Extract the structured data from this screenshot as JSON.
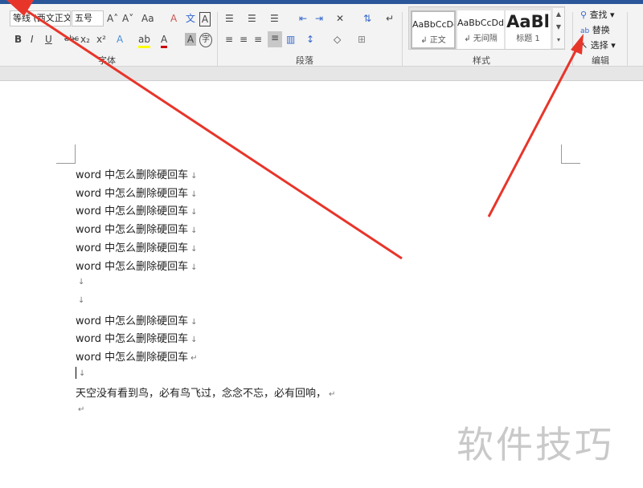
{
  "ribbon": {
    "font_name": "等线 (西文正文)",
    "font_size": "五号",
    "font_group": "字体",
    "paragraph_group": "段落",
    "styles_group": "样式",
    "editing_group": "编辑",
    "styles": [
      {
        "preview": "AaBbCcDd",
        "name": "↲ 正文"
      },
      {
        "preview": "AaBbCcDd",
        "name": "↲ 无间隔"
      },
      {
        "preview": "AaBl",
        "name": "标题 1"
      }
    ],
    "editing": {
      "find": "查找",
      "replace": "替换",
      "select": "选择"
    },
    "buttons": {
      "bold": "B",
      "italic": "I",
      "underline": "U",
      "strike": "abc",
      "sub": "x₂",
      "sup": "x²",
      "grow": "A˄",
      "shrink": "A˅",
      "case": "Aa",
      "clear": "A",
      "phonetic": "文",
      "border_char": "A",
      "effects": "A",
      "highlight": "ab",
      "color": "A",
      "shade": "A",
      "enclose": "字"
    }
  },
  "document": {
    "lines": [
      {
        "text": "word 中怎么删除硬回车",
        "mark": "↓"
      },
      {
        "text": "word 中怎么删除硬回车",
        "mark": "↓"
      },
      {
        "text": "word 中怎么删除硬回车",
        "mark": "↓"
      },
      {
        "text": "word 中怎么删除硬回车",
        "mark": "↓"
      },
      {
        "text": "word 中怎么删除硬回车",
        "mark": "↓"
      },
      {
        "text": "word 中怎么删除硬回车",
        "mark": "↓"
      },
      {
        "text": "",
        "mark": "↓"
      },
      {
        "text": "",
        "mark": "↓"
      },
      {
        "text": "word 中怎么删除硬回车",
        "mark": "↓"
      },
      {
        "text": "word 中怎么删除硬回车",
        "mark": "↓"
      },
      {
        "text": "word 中怎么删除硬回车",
        "mark": "↵"
      },
      {
        "text": "",
        "mark": "↓"
      },
      {
        "text": "天空没有看到鸟，必有鸟飞过，念念不忘，必有回响，",
        "mark": "↵"
      },
      {
        "text": "",
        "mark": "↵"
      }
    ]
  },
  "watermark": "软件技巧"
}
